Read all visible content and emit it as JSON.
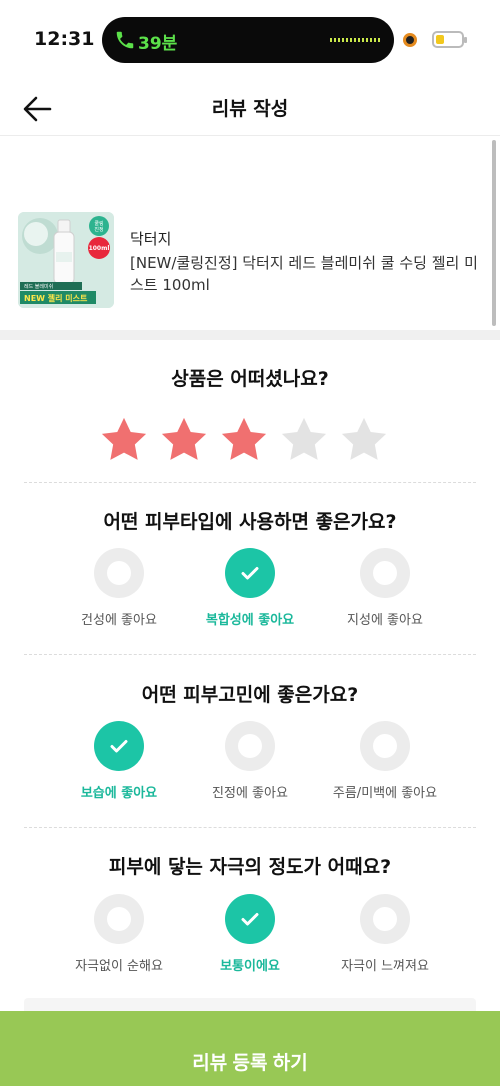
{
  "status_bar": {
    "time": "12:31",
    "call_duration": "39분",
    "battery_level": 0.35
  },
  "header": {
    "title": "리뷰 작성"
  },
  "product": {
    "brand": "닥터지",
    "name": "[NEW/쿨링진정] 닥터지 레드 블레미쉬 쿨 수딩 젤리 미스트 100ml",
    "thumb_badge_top": "쿨링\n진정",
    "thumb_badge_volume": "100ml",
    "thumb_banner_small": "레드 블레미쉬",
    "thumb_banner_large": "NEW 젤리 미스트"
  },
  "rating": {
    "question": "상품은 어떠셨나요?",
    "value": 3,
    "max": 5,
    "filled_color": "#f07070",
    "empty_color": "#e3e3e3"
  },
  "questions": [
    {
      "title": "어떤 피부타입에 사용하면 좋은가요?",
      "options": [
        {
          "label": "건성에 좋아요",
          "selected": false
        },
        {
          "label": "복합성에 좋아요",
          "selected": true
        },
        {
          "label": "지성에 좋아요",
          "selected": false
        }
      ]
    },
    {
      "title": "어떤 피부고민에 좋은가요?",
      "options": [
        {
          "label": "보습에 좋아요",
          "selected": true
        },
        {
          "label": "진정에 좋아요",
          "selected": false
        },
        {
          "label": "주름/미백에 좋아요",
          "selected": false
        }
      ]
    },
    {
      "title": "피부에 닿는 자극의 정도가 어때요?",
      "options": [
        {
          "label": "자극없이 순해요",
          "selected": false
        },
        {
          "label": "보통이에요",
          "selected": true
        },
        {
          "label": "자극이 느껴져요",
          "selected": false
        }
      ]
    }
  ],
  "submit": {
    "label": "리뷰 등록 하기"
  },
  "colors": {
    "accent": "#1cc5a6",
    "submit_bg": "#98c855",
    "call_green": "#5ce04a"
  }
}
